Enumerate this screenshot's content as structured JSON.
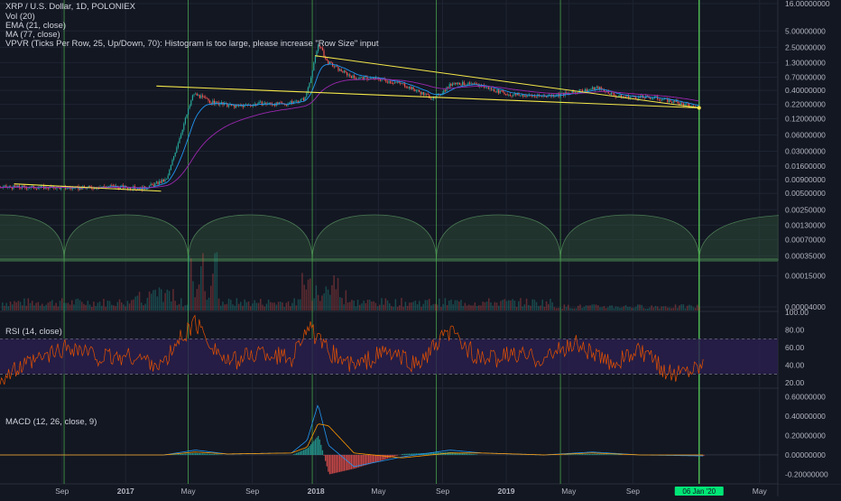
{
  "legend": {
    "symbol_line": "XRP / U.S. Dollar, 1D, POLONIEX",
    "vol": "Vol (20)",
    "ema": "EMA (21, close)",
    "ma": "MA (77, close)",
    "vpvr": "VPVR (Ticks Per Row, 25, Up/Down, 70): Histogram is too large, please increase \"Row Size\" input",
    "rsi": "RSI (14, close)",
    "macd": "MACD (12, 26, close, 9)"
  },
  "colors": {
    "background": "#131722",
    "grid": "#1f2433",
    "axis_text": "#b2b5be",
    "up_candle": "#26a69a",
    "down_candle": "#ef5350",
    "ema_line": "#2196f3",
    "ma_line": "#9c27b0",
    "trendline": "#f5e84a",
    "cycle_line": "#4caf50",
    "cycle_fill": "#2e4a36",
    "rsi_line": "#e65100",
    "rsi_band": "#2a1f4f",
    "macd_line": "#2196f3",
    "signal_line": "#ff9800",
    "date_highlight": "#00e676"
  },
  "chart_data": [
    {
      "type": "line",
      "name": "price",
      "scale": "log",
      "y_ticks": [
        "16.00000000",
        "5.00000000",
        "2.50000000",
        "1.30000000",
        "0.70000000",
        "0.40000000",
        "0.22000000",
        "0.12000000",
        "0.06000000",
        "0.03000000",
        "0.01600000",
        "0.00900000",
        "0.00500000",
        "0.00250000",
        "0.00130000",
        "0.00070000",
        "0.00035000",
        "0.00015000",
        "0.00004000"
      ],
      "x_ticks": [
        "Sep",
        "2017",
        "May",
        "Sep",
        "2018",
        "May",
        "Sep",
        "2019",
        "May",
        "Sep",
        "06 Jan '20",
        "May"
      ],
      "x": [
        "2016-08-01",
        "2016-10-01",
        "2016-12-01",
        "2017-02-01",
        "2017-03-20",
        "2017-04-05",
        "2017-05-10",
        "2017-06-15",
        "2017-08-01",
        "2017-09-15",
        "2017-11-01",
        "2017-12-10",
        "2017-12-25",
        "2018-01-05",
        "2018-01-20",
        "2018-02-10",
        "2018-03-15",
        "2018-05-01",
        "2018-06-15",
        "2018-08-15",
        "2018-09-20",
        "2018-11-15",
        "2019-01-01",
        "2019-03-01",
        "2019-05-01",
        "2019-06-25",
        "2019-08-01",
        "2019-10-15",
        "2019-12-15",
        "2020-01-06"
      ],
      "y": [
        0.0065,
        0.0062,
        0.0068,
        0.0061,
        0.009,
        0.03,
        0.35,
        0.24,
        0.2,
        0.23,
        0.22,
        0.28,
        1.0,
        3.0,
        1.4,
        1.0,
        0.68,
        0.65,
        0.52,
        0.28,
        0.56,
        0.48,
        0.34,
        0.31,
        0.35,
        0.45,
        0.31,
        0.29,
        0.21,
        0.19
      ],
      "series": [
        {
          "name": "EMA (21, close)"
        },
        {
          "name": "MA (77, close)"
        }
      ],
      "trendlines": [
        {
          "from": [
            "2016-06-01",
            0.0075
          ],
          "to": [
            "2017-03-10",
            0.0055
          ]
        },
        {
          "from": [
            "2017-03-01",
            0.48
          ],
          "to": [
            "2020-01-06",
            0.19
          ]
        },
        {
          "from": [
            "2017-12-30",
            1.75
          ],
          "to": [
            "2020-01-06",
            0.19
          ]
        }
      ],
      "cycle_dates": [
        "2016-09-05",
        "2017-05-01",
        "2017-12-25",
        "2018-08-20",
        "2019-04-15",
        "2020-01-06"
      ]
    },
    {
      "type": "line",
      "name": "RSI (14, close)",
      "y_ticks": [
        "100.00",
        "80.00",
        "60.00",
        "40.00",
        "20.00"
      ],
      "ylim": [
        15,
        100
      ],
      "band": [
        30,
        70
      ],
      "x": [
        "2016-07",
        "2016-09",
        "2016-11",
        "2017-01",
        "2017-03",
        "2017-04",
        "2017-05",
        "2017-07",
        "2017-09",
        "2017-11",
        "2017-12",
        "2018-01",
        "2018-03",
        "2018-05",
        "2018-07",
        "2018-09",
        "2018-11",
        "2019-01",
        "2019-03",
        "2019-05",
        "2019-07",
        "2019-09",
        "2019-11",
        "2020-01"
      ],
      "values": [
        45,
        62,
        48,
        50,
        40,
        70,
        88,
        42,
        55,
        48,
        85,
        60,
        38,
        55,
        40,
        78,
        45,
        52,
        48,
        65,
        42,
        55,
        30,
        42
      ]
    },
    {
      "type": "line",
      "name": "MACD (12, 26, close, 9)",
      "y_ticks": [
        "0.60000000",
        "0.40000000",
        "0.20000000",
        "0.00000000",
        "-0.20000000"
      ],
      "ylim": [
        -0.26,
        0.64
      ],
      "x": [
        "2016-07",
        "2017-03",
        "2017-05",
        "2017-07",
        "2017-11",
        "2017-12-15",
        "2018-01-05",
        "2018-01-25",
        "2018-03",
        "2018-06",
        "2018-09",
        "2018-11",
        "2019-03",
        "2019-06",
        "2019-09",
        "2020-01"
      ],
      "values": [
        0,
        0,
        0.05,
        0.01,
        0.02,
        0.15,
        0.52,
        0.1,
        -0.12,
        -0.02,
        0.05,
        0.02,
        0.0,
        0.03,
        0.0,
        -0.01
      ],
      "signal": [
        0,
        0,
        0.03,
        0.01,
        0.02,
        0.08,
        0.32,
        0.3,
        0.02,
        -0.03,
        0.02,
        0.02,
        0.0,
        0.02,
        0.0,
        0.0
      ]
    }
  ]
}
